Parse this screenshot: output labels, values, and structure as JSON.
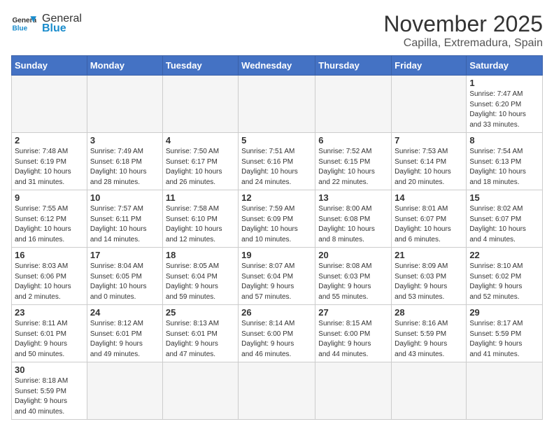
{
  "header": {
    "logo_general": "General",
    "logo_blue": "Blue",
    "month_title": "November 2025",
    "location": "Capilla, Extremadura, Spain"
  },
  "weekdays": [
    "Sunday",
    "Monday",
    "Tuesday",
    "Wednesday",
    "Thursday",
    "Friday",
    "Saturday"
  ],
  "weeks": [
    [
      {
        "day": "",
        "info": ""
      },
      {
        "day": "",
        "info": ""
      },
      {
        "day": "",
        "info": ""
      },
      {
        "day": "",
        "info": ""
      },
      {
        "day": "",
        "info": ""
      },
      {
        "day": "",
        "info": ""
      },
      {
        "day": "1",
        "info": "Sunrise: 7:47 AM\nSunset: 6:20 PM\nDaylight: 10 hours\nand 33 minutes."
      }
    ],
    [
      {
        "day": "2",
        "info": "Sunrise: 7:48 AM\nSunset: 6:19 PM\nDaylight: 10 hours\nand 31 minutes."
      },
      {
        "day": "3",
        "info": "Sunrise: 7:49 AM\nSunset: 6:18 PM\nDaylight: 10 hours\nand 28 minutes."
      },
      {
        "day": "4",
        "info": "Sunrise: 7:50 AM\nSunset: 6:17 PM\nDaylight: 10 hours\nand 26 minutes."
      },
      {
        "day": "5",
        "info": "Sunrise: 7:51 AM\nSunset: 6:16 PM\nDaylight: 10 hours\nand 24 minutes."
      },
      {
        "day": "6",
        "info": "Sunrise: 7:52 AM\nSunset: 6:15 PM\nDaylight: 10 hours\nand 22 minutes."
      },
      {
        "day": "7",
        "info": "Sunrise: 7:53 AM\nSunset: 6:14 PM\nDaylight: 10 hours\nand 20 minutes."
      },
      {
        "day": "8",
        "info": "Sunrise: 7:54 AM\nSunset: 6:13 PM\nDaylight: 10 hours\nand 18 minutes."
      }
    ],
    [
      {
        "day": "9",
        "info": "Sunrise: 7:55 AM\nSunset: 6:12 PM\nDaylight: 10 hours\nand 16 minutes."
      },
      {
        "day": "10",
        "info": "Sunrise: 7:57 AM\nSunset: 6:11 PM\nDaylight: 10 hours\nand 14 minutes."
      },
      {
        "day": "11",
        "info": "Sunrise: 7:58 AM\nSunset: 6:10 PM\nDaylight: 10 hours\nand 12 minutes."
      },
      {
        "day": "12",
        "info": "Sunrise: 7:59 AM\nSunset: 6:09 PM\nDaylight: 10 hours\nand 10 minutes."
      },
      {
        "day": "13",
        "info": "Sunrise: 8:00 AM\nSunset: 6:08 PM\nDaylight: 10 hours\nand 8 minutes."
      },
      {
        "day": "14",
        "info": "Sunrise: 8:01 AM\nSunset: 6:07 PM\nDaylight: 10 hours\nand 6 minutes."
      },
      {
        "day": "15",
        "info": "Sunrise: 8:02 AM\nSunset: 6:07 PM\nDaylight: 10 hours\nand 4 minutes."
      }
    ],
    [
      {
        "day": "16",
        "info": "Sunrise: 8:03 AM\nSunset: 6:06 PM\nDaylight: 10 hours\nand 2 minutes."
      },
      {
        "day": "17",
        "info": "Sunrise: 8:04 AM\nSunset: 6:05 PM\nDaylight: 10 hours\nand 0 minutes."
      },
      {
        "day": "18",
        "info": "Sunrise: 8:05 AM\nSunset: 6:04 PM\nDaylight: 9 hours\nand 59 minutes."
      },
      {
        "day": "19",
        "info": "Sunrise: 8:07 AM\nSunset: 6:04 PM\nDaylight: 9 hours\nand 57 minutes."
      },
      {
        "day": "20",
        "info": "Sunrise: 8:08 AM\nSunset: 6:03 PM\nDaylight: 9 hours\nand 55 minutes."
      },
      {
        "day": "21",
        "info": "Sunrise: 8:09 AM\nSunset: 6:03 PM\nDaylight: 9 hours\nand 53 minutes."
      },
      {
        "day": "22",
        "info": "Sunrise: 8:10 AM\nSunset: 6:02 PM\nDaylight: 9 hours\nand 52 minutes."
      }
    ],
    [
      {
        "day": "23",
        "info": "Sunrise: 8:11 AM\nSunset: 6:01 PM\nDaylight: 9 hours\nand 50 minutes."
      },
      {
        "day": "24",
        "info": "Sunrise: 8:12 AM\nSunset: 6:01 PM\nDaylight: 9 hours\nand 49 minutes."
      },
      {
        "day": "25",
        "info": "Sunrise: 8:13 AM\nSunset: 6:01 PM\nDaylight: 9 hours\nand 47 minutes."
      },
      {
        "day": "26",
        "info": "Sunrise: 8:14 AM\nSunset: 6:00 PM\nDaylight: 9 hours\nand 46 minutes."
      },
      {
        "day": "27",
        "info": "Sunrise: 8:15 AM\nSunset: 6:00 PM\nDaylight: 9 hours\nand 44 minutes."
      },
      {
        "day": "28",
        "info": "Sunrise: 8:16 AM\nSunset: 5:59 PM\nDaylight: 9 hours\nand 43 minutes."
      },
      {
        "day": "29",
        "info": "Sunrise: 8:17 AM\nSunset: 5:59 PM\nDaylight: 9 hours\nand 41 minutes."
      }
    ],
    [
      {
        "day": "30",
        "info": "Sunrise: 8:18 AM\nSunset: 5:59 PM\nDaylight: 9 hours\nand 40 minutes."
      },
      {
        "day": "",
        "info": ""
      },
      {
        "day": "",
        "info": ""
      },
      {
        "day": "",
        "info": ""
      },
      {
        "day": "",
        "info": ""
      },
      {
        "day": "",
        "info": ""
      },
      {
        "day": "",
        "info": ""
      }
    ]
  ]
}
